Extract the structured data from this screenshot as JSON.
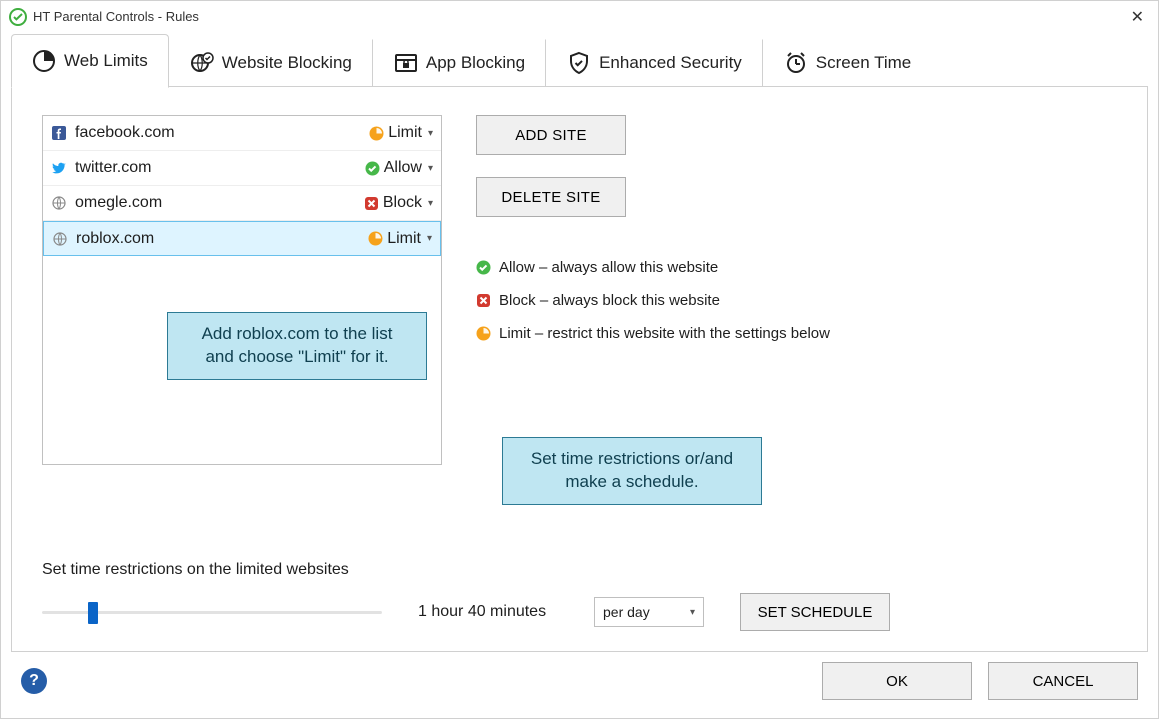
{
  "window": {
    "title": "HT Parental Controls - Rules"
  },
  "tabs": [
    {
      "label": "Web Limits"
    },
    {
      "label": "Website Blocking"
    },
    {
      "label": "App Blocking"
    },
    {
      "label": "Enhanced Security"
    },
    {
      "label": "Screen Time"
    }
  ],
  "sites": {
    "facebook": {
      "domain": "facebook.com",
      "action": "Limit"
    },
    "twitter": {
      "domain": "twitter.com",
      "action": "Allow"
    },
    "omegle": {
      "domain": "omegle.com",
      "action": "Block"
    },
    "roblox": {
      "domain": "roblox.com",
      "action": "Limit"
    }
  },
  "buttons": {
    "add_site": "ADD SITE",
    "delete_site": "DELETE SITE",
    "set_schedule": "SET SCHEDULE",
    "ok": "OK",
    "cancel": "CANCEL"
  },
  "legend": {
    "allow": "Allow – always allow this website",
    "block": "Block – always block this website",
    "limit": "Limit – restrict this website with the settings below"
  },
  "callouts": {
    "add_limit": "Add roblox.com to the list\nand choose \"Limit\" for it.",
    "time": "Set time restrictions or/and\nmake a schedule."
  },
  "time": {
    "section_label": "Set time restrictions on the limited websites",
    "duration_text": "1 hour 40 minutes",
    "period_selected": "per day",
    "slider_percent": 14
  }
}
